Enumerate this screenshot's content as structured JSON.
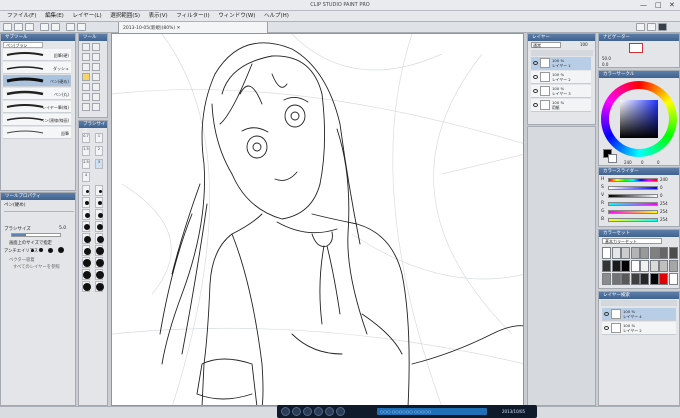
{
  "window": {
    "title": "CLIP STUDIO PAINT PRO",
    "min": "—",
    "max": "□",
    "close": "✕"
  },
  "menu": [
    "ファイル(F)",
    "編集(E)",
    "レイヤー(L)",
    "選択範囲(S)",
    "表示(V)",
    "フィルター(I)",
    "ウィンドウ(W)",
    "ヘルプ(H)"
  ],
  "doc_tab": "2013-10-05(新規)(80%)  ✕",
  "subtool": {
    "header": "サブツール",
    "tab": "ペン|ブラシ",
    "brushes": [
      {
        "label": "鉛筆(硬)"
      },
      {
        "label": "ダッシュ"
      },
      {
        "label": "ペン(硬め)"
      },
      {
        "label": "ペン(丸)"
      },
      {
        "label": "レイヤー筆(線)"
      },
      {
        "label": "ペン(黒線/線画)"
      },
      {
        "label": "鉛筆"
      }
    ]
  },
  "tool_header": "ツール",
  "brush_size_header": "ブラシサイズ",
  "brush_sizes": [
    "0.7",
    "1",
    "1.5",
    "2",
    "2.5",
    "3",
    "4"
  ],
  "tool_property": {
    "header": "ツールプロパティ",
    "title": "ペン(硬め)",
    "brush_size_label": "ブラシサイズ",
    "brush_size_value": "5.0",
    "option": "画面上のサイズで指定",
    "antialias": "アンチエイリアス",
    "vector": "ベクター吸着",
    "snap": "すべてのレイヤーを参照"
  },
  "layers": {
    "header": "レイヤー",
    "blend": "通常",
    "opacity": "100",
    "items": [
      {
        "opacity": "100 %",
        "mode": "通常",
        "name": "レイヤー 1"
      },
      {
        "opacity": "100 %",
        "mode": "通常",
        "name": "レイヤー 2"
      },
      {
        "opacity": "100 %",
        "mode": "通常",
        "name": "レイヤー 3"
      },
      {
        "opacity": "100 %",
        "mode": "通常",
        "name": "用紙"
      }
    ]
  },
  "navigator": {
    "header": "ナビゲーター",
    "zoom": "50.0",
    "angle": "0.0"
  },
  "color_wheel": {
    "header": "カラーサークル",
    "h": "240",
    "s": "0",
    "v": "0"
  },
  "color_slider": {
    "header": "カラースライダー",
    "rows": [
      {
        "label": "H",
        "value": "240"
      },
      {
        "label": "S",
        "value": "0"
      },
      {
        "label": "V",
        "value": "0"
      },
      {
        "label": "R",
        "value": "254"
      },
      {
        "label": "G",
        "value": "254"
      },
      {
        "label": "B",
        "value": "254"
      }
    ]
  },
  "color_set": {
    "header": "カラーセット",
    "name": "基本カラーセット",
    "swatches": [
      "#ffffff",
      "#e6e6e6",
      "#cccccc",
      "#b3b3b3",
      "#999999",
      "#808080",
      "#666666",
      "#4d4d4d",
      "#333333",
      "#1a1a1a",
      "#000000",
      "#ffffff",
      "#f0f0f0",
      "#d9d9d9",
      "#bfbfbf",
      "#a6a6a6",
      "#8c8c8c",
      "#737373",
      "#595959",
      "#404040",
      "#262626",
      "#000000",
      "#e10000",
      "#ffffff"
    ]
  },
  "layers2": {
    "header": "レイヤー検索",
    "items": [
      {
        "opacity": "100 %",
        "mode": "通常",
        "name": "レイヤー 4"
      },
      {
        "opacity": "100 %",
        "mode": "通常",
        "name": "レイヤー 2"
      }
    ]
  },
  "taskbar": {
    "time": "2013/10/05",
    "status": "○○○ ○○○○○○ ○○○○○"
  }
}
